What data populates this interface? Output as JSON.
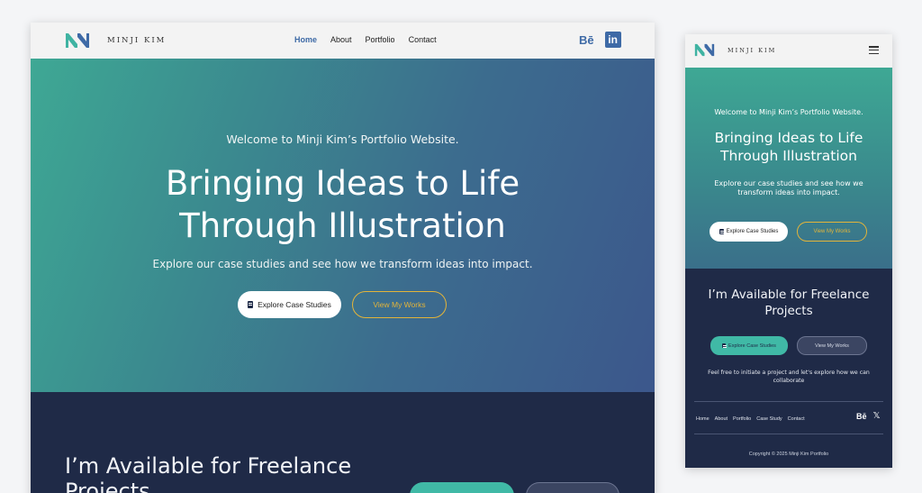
{
  "brand": {
    "name": "MINJI KIM",
    "colors": {
      "teal": "#3ea894",
      "blue": "#3e6aa6",
      "navy": "#1f2a47",
      "gold": "#e3b43a"
    }
  },
  "nav": {
    "links": [
      "Home",
      "About",
      "Portfolio",
      "Contact"
    ],
    "active": "Home",
    "social": {
      "behance": "Bē",
      "linkedin": "in"
    }
  },
  "hero": {
    "welcome": "Welcome to Minji Kim’s Portfolio Website.",
    "title": "Bringing Ideas to Life Through Illustration",
    "subtitle": "Explore our case studies and see how we transform ideas into impact.",
    "primary_button": "Explore Case Studies",
    "secondary_button": "View My Works"
  },
  "freelance": {
    "title": "I’m Available for Freelance Projects",
    "primary_button": "Explore Case Studies",
    "secondary_button": "View My Works",
    "description": "Feel free to initiate a project and let's explore how we can collaborate"
  },
  "footer": {
    "links": [
      "Home",
      "About",
      "Portfolio",
      "Case Study",
      "Contact"
    ],
    "social": {
      "behance": "Bē",
      "x": "𝕏"
    },
    "copyright": "Copyright © 2025 Minji Kim Portfolio"
  }
}
